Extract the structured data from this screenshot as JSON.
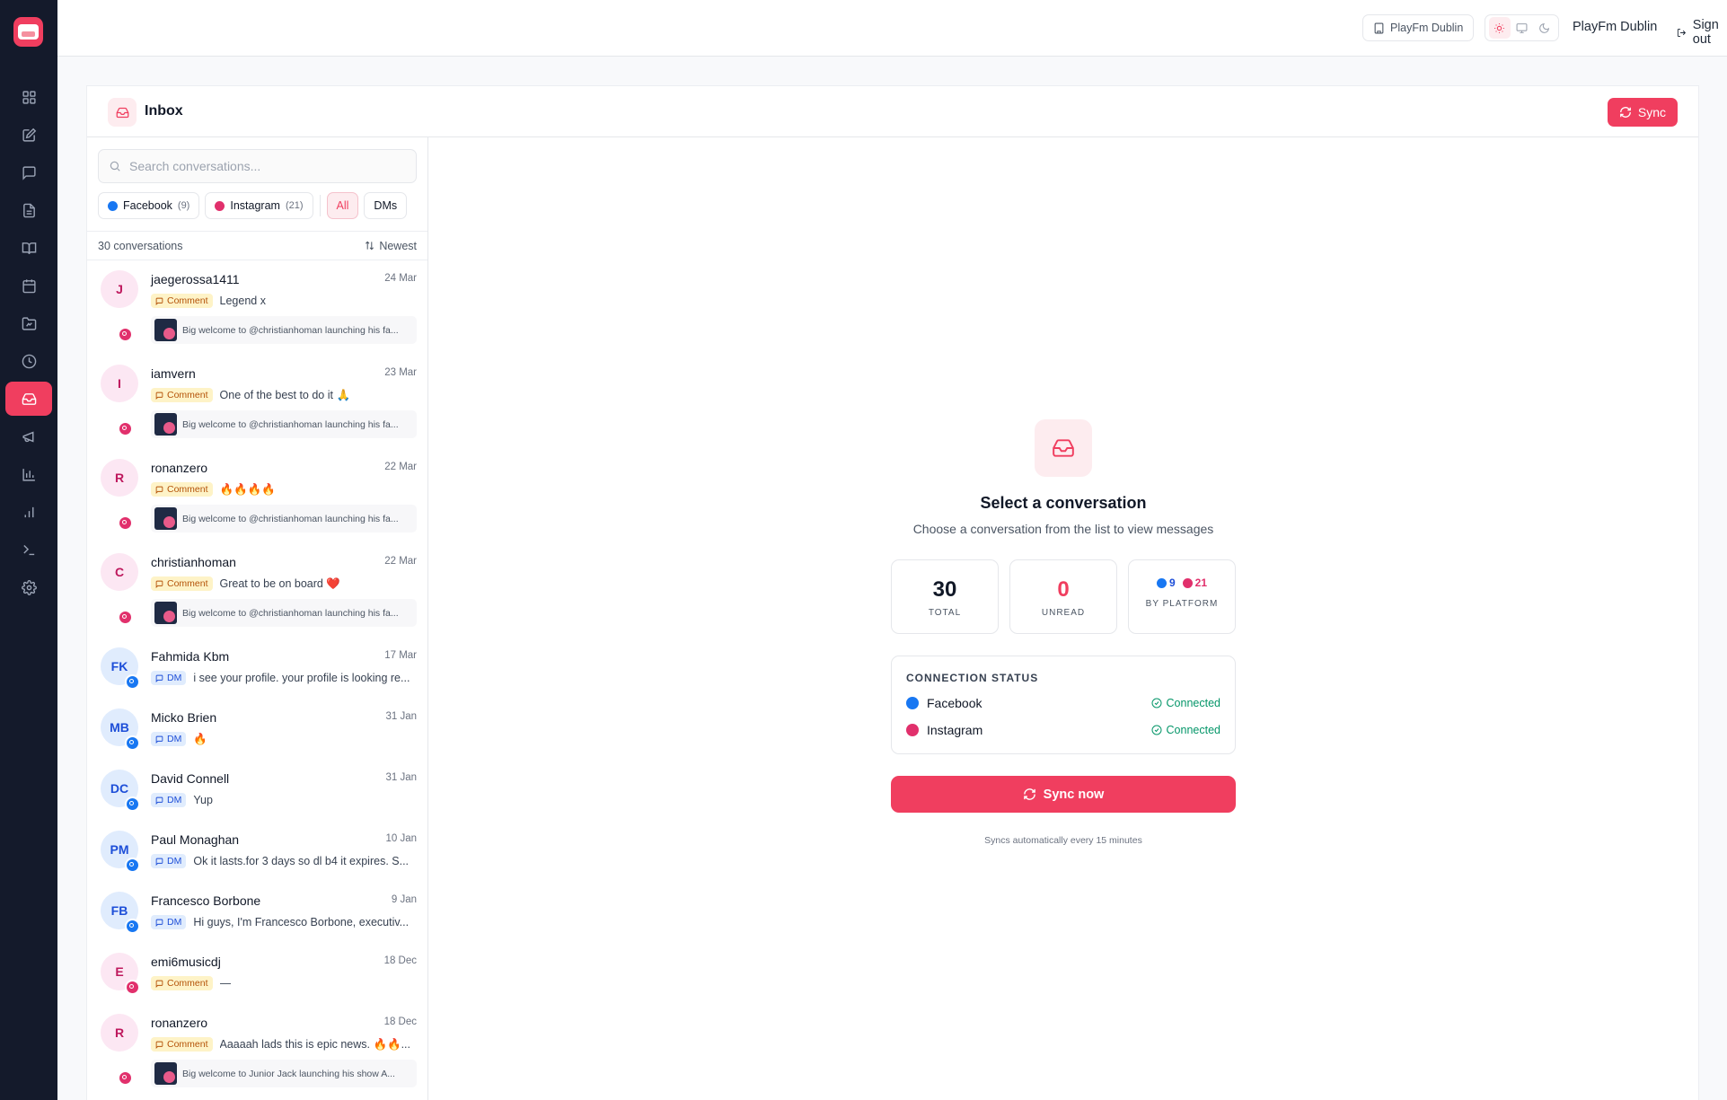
{
  "topbar": {
    "page_chip": "PlayFm Dublin",
    "user_name": "PlayFm Dublin",
    "signout_label": "Sign out",
    "theme_options": [
      "sun-icon",
      "monitor-icon",
      "moon-icon"
    ]
  },
  "sidebar": {
    "items": [
      "dashboard-icon",
      "compose-icon",
      "messages-icon",
      "document-icon",
      "book-icon",
      "calendar-icon",
      "media-folder-icon",
      "history-icon",
      "inbox-icon",
      "campaign-icon",
      "bar-chart-icon",
      "analytics-icon",
      "terminal-icon",
      "settings-icon"
    ],
    "active": "inbox-icon"
  },
  "inbox": {
    "title": "Inbox",
    "sync_label": "Sync",
    "search_placeholder": "Search conversations...",
    "filters": {
      "facebook": {
        "label": "Facebook",
        "count": "(9)"
      },
      "instagram": {
        "label": "Instagram",
        "count": "(21)"
      },
      "all": "All",
      "dms": "DMs"
    },
    "count_label": "30 conversations",
    "sort_label": "Newest",
    "conversations": [
      {
        "initials": "J",
        "name": "jaegerossa1411",
        "date": "24 Mar",
        "type": "Comment",
        "text": "Legend x",
        "platform": "instagram",
        "post": "Big welcome to @christianhoman launching his fa..."
      },
      {
        "initials": "I",
        "name": "iamvern",
        "date": "23 Mar",
        "type": "Comment",
        "text": "One of the best to do it 🙏",
        "platform": "instagram",
        "post": "Big welcome to @christianhoman launching his fa..."
      },
      {
        "initials": "R",
        "name": "ronanzero",
        "date": "22 Mar",
        "type": "Comment",
        "text": "🔥🔥🔥🔥",
        "platform": "instagram",
        "post": "Big welcome to @christianhoman launching his fa..."
      },
      {
        "initials": "C",
        "name": "christianhoman",
        "date": "22 Mar",
        "type": "Comment",
        "text": "Great to be on board ❤️",
        "platform": "instagram",
        "post": "Big welcome to @christianhoman launching his fa..."
      },
      {
        "initials": "FK",
        "name": "Fahmida Kbm",
        "date": "17 Mar",
        "type": "DM",
        "text": "i see your profile. your profile is looking re...",
        "platform": "facebook"
      },
      {
        "initials": "MB",
        "name": "Micko Brien",
        "date": "31 Jan",
        "type": "DM",
        "text": "🔥",
        "platform": "facebook"
      },
      {
        "initials": "DC",
        "name": "David Connell",
        "date": "31 Jan",
        "type": "DM",
        "text": "Yup",
        "platform": "facebook"
      },
      {
        "initials": "PM",
        "name": "Paul Monaghan",
        "date": "10 Jan",
        "type": "DM",
        "text": "Ok it lasts.for 3 days so dl b4 it expires. S...",
        "platform": "facebook"
      },
      {
        "initials": "FB",
        "name": "Francesco Borbone",
        "date": "9 Jan",
        "type": "DM",
        "text": "Hi guys,  I'm Francesco Borbone, executiv...",
        "platform": "facebook"
      },
      {
        "initials": "E",
        "name": "emi6musicdj",
        "date": "18 Dec",
        "type": "Comment",
        "text": "—",
        "platform": "instagram"
      },
      {
        "initials": "R",
        "name": "ronanzero",
        "date": "18 Dec",
        "type": "Comment",
        "text": "Aaaaah lads this is epic news. 🔥🔥...",
        "platform": "instagram",
        "post": "Big welcome to Junior Jack launching his show A..."
      }
    ]
  },
  "empty_state": {
    "title": "Select a conversation",
    "subtitle": "Choose a conversation from the list to view messages",
    "stats": {
      "total": {
        "value": "30",
        "label": "TOTAL"
      },
      "unread": {
        "value": "0",
        "label": "UNREAD"
      },
      "platform": {
        "facebook": "9",
        "instagram": "21",
        "label": "BY PLATFORM"
      }
    },
    "connection": {
      "title": "CONNECTION STATUS",
      "facebook": {
        "label": "Facebook",
        "status": "Connected"
      },
      "instagram": {
        "label": "Instagram",
        "status": "Connected"
      }
    },
    "sync_now_label": "Sync now",
    "sync_note": "Syncs automatically every 15 minutes"
  },
  "colors": {
    "accent": "#f03e5f",
    "sidebar_bg": "#141a2b",
    "connected": "#059669",
    "facebook": "#1877f2",
    "instagram": "#e1306c"
  }
}
